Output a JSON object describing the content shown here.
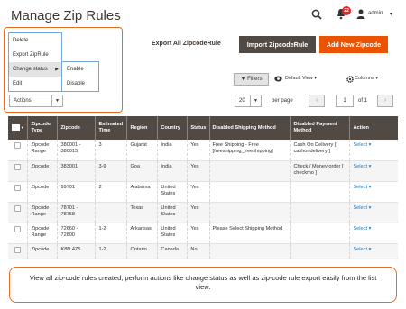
{
  "header": {
    "title": "Manage Zip Rules",
    "notification_count": "22",
    "user_label": "admin"
  },
  "toolbar": {
    "export_all": "Export All ZipcodeRule",
    "import": "Import ZipcodeRule",
    "add_new": "Add New Zipcode"
  },
  "actions_menu": {
    "items": [
      "Delete",
      "Export ZipRule",
      "Change status",
      "Edit"
    ],
    "submenu": [
      "Enable",
      "Disable"
    ],
    "select_label": "Actions"
  },
  "controls": {
    "filters": "Filters",
    "view": "Default View",
    "columns": "Columns",
    "per_page_value": "20",
    "per_page_label": "per page",
    "page_value": "1",
    "of_label": "of 1"
  },
  "table": {
    "headers": [
      "Zipcode Type",
      "Zipcode",
      "Estimated Time",
      "Region",
      "Country",
      "Status",
      "Disabled Shipping Method",
      "Disabled Payment Method",
      "Action"
    ],
    "rows": [
      [
        "Zipcode Range",
        "380001 - 380015",
        "3",
        "Gujarat",
        "India",
        "Yes",
        "Free Shipping - Free [freeshipping_freeshipping]",
        "Cash On Delivery [ cashondelivery ]",
        "Select"
      ],
      [
        "Zipcode",
        "383001",
        "3-9",
        "Goa",
        "India",
        "Yes",
        "",
        "Check / Money order [ checkmo ]",
        "Select"
      ],
      [
        "Zipcode",
        "99701",
        "2",
        "Alabama",
        "United States",
        "Yes",
        "",
        "",
        "Select"
      ],
      [
        "Zipcode Range",
        "78701 - 78758",
        "",
        "Texas",
        "United States",
        "Yes",
        "",
        "",
        "Select"
      ],
      [
        "Zipcode Range",
        "72660 - 72800",
        "1-2",
        "Arkansas",
        "United States",
        "Yes",
        "Please Select Shipping Method",
        "",
        "Select"
      ],
      [
        "Zipcode",
        "K8N 4Z5",
        "1-2",
        "Ontario",
        "Canada",
        "No",
        "",
        "",
        "Select"
      ]
    ]
  },
  "caption": "View all zip-code rules created, perform actions like change status as well as zip-code rule export easily from the list view.",
  "colors": {
    "accent": "#eb5202",
    "header_dark": "#514943",
    "link": "#1979c3"
  }
}
